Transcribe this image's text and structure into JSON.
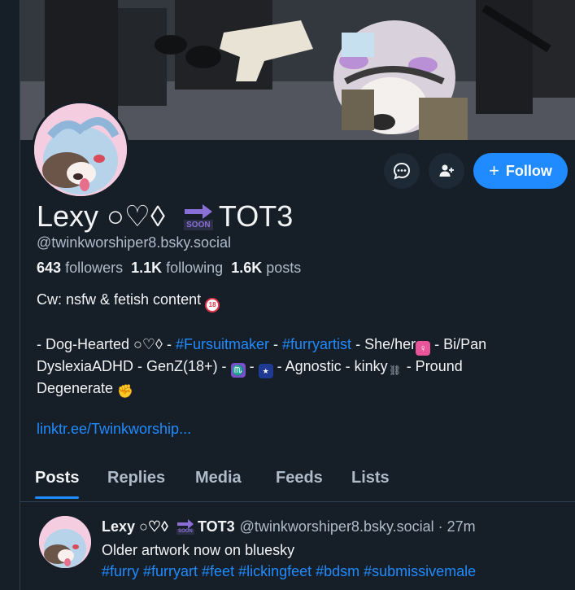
{
  "banner": {
    "alt": ""
  },
  "profile": {
    "display_name": "Lexy ○♡◊",
    "name_suffix": "TOT3",
    "soon_label": "SOON",
    "handle": "@twinkworshiper8.bsky.social",
    "followers_count": "643",
    "followers_label": "followers",
    "following_count": "1.1K",
    "following_label": "following",
    "posts_count": "1.6K",
    "posts_label": "posts",
    "follow_label": "Follow",
    "bio_line1": "Cw: nsfw & fetish content",
    "bio_line3_a": "- Dog-Hearted ○♡◊ -",
    "bio_tag1": "#Fursuitmaker",
    "bio_line3_b": "-",
    "bio_tag2": "#furryartist",
    "bio_line3_c": "- She/her",
    "bio_line3_d": "- Bi/Pan",
    "bio_line4_a": "DyslexiaADHD - GenZ(18+) -",
    "bio_line4_b": "-",
    "bio_line4_c": "- Agnostic - kinky",
    "bio_line4_d": "- Pround",
    "bio_line5": "Degenerate",
    "link": "linktr.ee/Twinkworship..."
  },
  "tabs": [
    {
      "label": "Posts"
    },
    {
      "label": "Replies"
    },
    {
      "label": "Media"
    },
    {
      "label": "Feeds"
    },
    {
      "label": "Lists"
    }
  ],
  "post": {
    "author": "Lexy ○♡◊",
    "author_suffix": "TOT3",
    "soon_label": "SOON",
    "handle": "@twinkworshiper8.bsky.social · 27m",
    "text": "Older artwork now on bluesky",
    "tags": "#furry #furryart #feet #lickingfeet #bdsm #submissivemale"
  },
  "colors": {
    "accent": "#208bfe",
    "background": "#161e27",
    "secondary_text": "#aebbc9"
  }
}
